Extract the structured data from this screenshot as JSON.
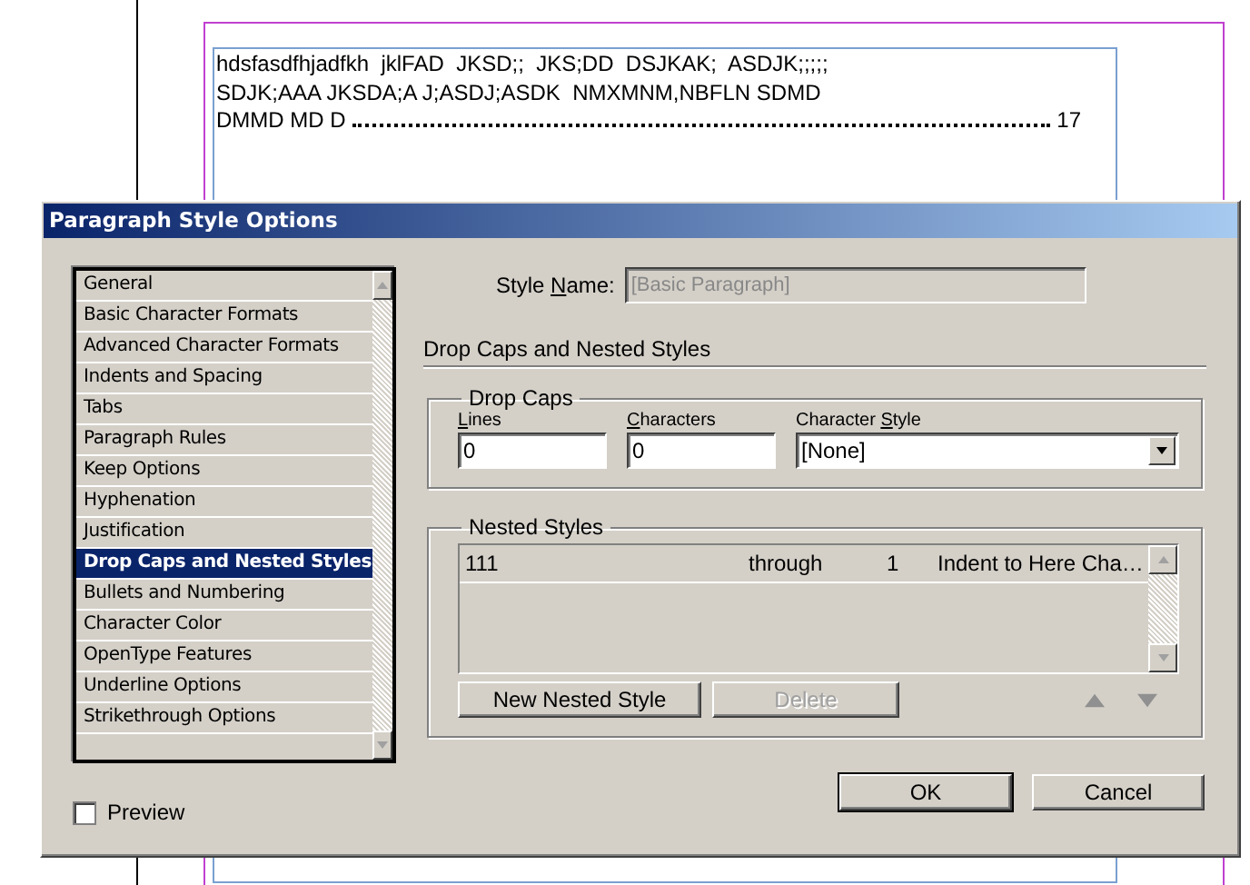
{
  "document": {
    "lines": [
      "hdsfasdfhjadfkh  jklFAD  JKSD;;  JKS;DD  DSJKAK;  ASDJK;;;;;",
      "SDJK;AAA JKSDA;A J;ASDJ;ASDK  NMXMNM,NBFLN SDMD"
    ],
    "toc_entry": {
      "text": "DMMD MD D",
      "page": "17"
    }
  },
  "dialog": {
    "title": "Paragraph Style Options",
    "categories": [
      {
        "label": "General",
        "selected": false
      },
      {
        "label": "Basic Character Formats",
        "selected": false
      },
      {
        "label": "Advanced Character Formats",
        "selected": false
      },
      {
        "label": "Indents and Spacing",
        "selected": false
      },
      {
        "label": "Tabs",
        "selected": false
      },
      {
        "label": "Paragraph Rules",
        "selected": false
      },
      {
        "label": "Keep Options",
        "selected": false
      },
      {
        "label": "Hyphenation",
        "selected": false
      },
      {
        "label": "Justification",
        "selected": false
      },
      {
        "label": "Drop Caps and Nested Styles",
        "selected": true
      },
      {
        "label": "Bullets and Numbering",
        "selected": false
      },
      {
        "label": "Character Color",
        "selected": false
      },
      {
        "label": "OpenType Features",
        "selected": false
      },
      {
        "label": "Underline Options",
        "selected": false
      },
      {
        "label": "Strikethrough Options",
        "selected": false
      }
    ],
    "preview": {
      "label": "Preview",
      "checked": false
    },
    "style_name": {
      "label": {
        "before": "Style ",
        "key": "N",
        "after": "ame:"
      },
      "value": "[Basic Paragraph]",
      "disabled": true
    },
    "section_title": "Drop Caps and Nested Styles",
    "drop_caps": {
      "title": "Drop Caps",
      "fields": [
        {
          "kind": "text",
          "label": {
            "key": "L",
            "after": "ines"
          },
          "value": "0"
        },
        {
          "kind": "text",
          "label": {
            "key": "C",
            "after": "haracters"
          },
          "value": "0"
        },
        {
          "kind": "dropdown",
          "label": {
            "before": "Character ",
            "key": "S",
            "after": "tyle"
          },
          "value": "[None]"
        }
      ]
    },
    "nested_styles": {
      "title": "Nested Styles",
      "rows": [
        {
          "columns": [
            "111",
            "through",
            "1",
            "Indent to Here Cha…"
          ],
          "selected": false
        }
      ],
      "buttons": [
        {
          "label": "New Nested Style",
          "disabled": false
        },
        {
          "label": "Delete",
          "disabled": true
        }
      ],
      "move_up": {
        "disabled": true
      },
      "move_down": {
        "disabled": true
      }
    },
    "buttons": [
      {
        "label": "OK",
        "default": true
      },
      {
        "label": "Cancel",
        "default": false
      }
    ]
  }
}
